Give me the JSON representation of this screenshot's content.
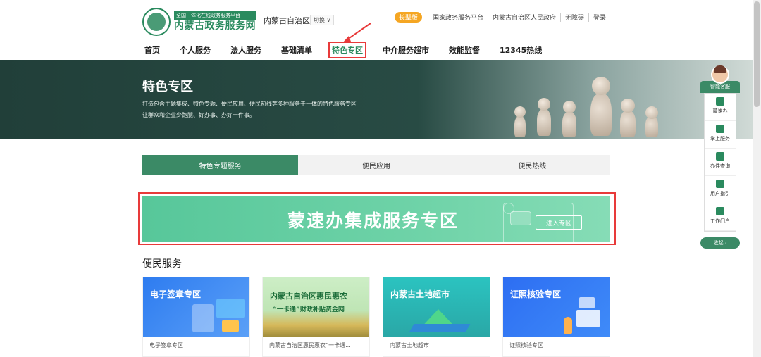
{
  "header": {
    "logo_tag": "全国一体化在线政务服务平台",
    "logo_name": "内蒙古政务服务网",
    "region": "内蒙古自治区",
    "switch_label": "切换 ∨"
  },
  "topbar": {
    "elder_label": "长辈版",
    "links": [
      "国家政务服务平台",
      "内蒙古自治区人民政府",
      "无障碍",
      "登录"
    ]
  },
  "nav": {
    "items": [
      "首页",
      "个人服务",
      "法人服务",
      "基础清单",
      "特色专区",
      "中介服务超市",
      "效能监督",
      "12345热线"
    ],
    "active_index": 4
  },
  "banner": {
    "title": "特色专区",
    "desc_line1": "打造包含主题集成、特色专题、便民应用、便民热线等多种服务于一体的特色服务专区",
    "desc_line2": "让群众和企业少跑腿、好办事、办好一件事。"
  },
  "tabs": [
    "特色专题服务",
    "便民应用",
    "便民热线"
  ],
  "feature": {
    "title": "蒙速办集成服务专区",
    "button": "进入专区"
  },
  "section": {
    "title": "便民服务",
    "cards": [
      {
        "img_title": "电子签章专区",
        "label": "电子签章专区"
      },
      {
        "img_title": "内蒙古自治区惠民惠农",
        "img_sub": "“一卡通”财政补贴资金网",
        "label": "内蒙古自治区惠民惠农“一卡通..."
      },
      {
        "img_title": "内蒙古土地超市",
        "label": "内蒙古土地超市"
      },
      {
        "img_title": "证照核验专区",
        "label": "证照核验专区"
      }
    ]
  },
  "float_panel": {
    "head": "智能客服",
    "items": [
      "蒙速办",
      "掌上服务",
      "办件查询",
      "用户指引",
      "工作门户"
    ],
    "fold": "收起 ›"
  },
  "colors": {
    "brand": "#2a8a5e",
    "highlight": "#e83a3a",
    "elder": "#f5a623"
  }
}
